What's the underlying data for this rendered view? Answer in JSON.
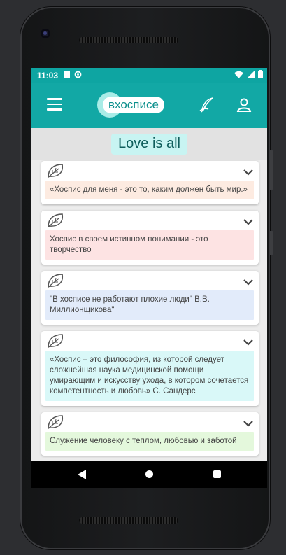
{
  "status_bar": {
    "time": "11:03",
    "icons": [
      "sd-card-icon",
      "sync-icon",
      "wifi-icon",
      "signal-icon",
      "battery-icon"
    ]
  },
  "app_bar": {
    "logo_text": "вхосписе",
    "menu_icon": "hamburger-menu-icon",
    "write_icon": "quill-pen-icon",
    "profile_icon": "person-icon",
    "color": "#12a8a5"
  },
  "section": {
    "title": "Love is all"
  },
  "cards": [
    {
      "text": "«Хоспис для меня - это то, каким должен быть мир.»",
      "bg": "#fdebe1"
    },
    {
      "text": "Хоспис в своем истинном понимании - это творчество",
      "bg": "#fde3e3"
    },
    {
      "text": "\"В хосписе не работают плохие люди\" В.В. Миллионщикова\"",
      "bg": "#e2ebfa"
    },
    {
      "text": "«Хоспис – это философия, из которой следует сложнейшая наука медицинской помощи умирающим и искусству ухода, в котором сочетается компетентность и любовь» С. Сандерс",
      "bg": "#d9f8f8"
    },
    {
      "text": "Служение человеку с теплом, любовью и заботой",
      "bg": "#e4f8dc"
    }
  ],
  "nav_bar": {
    "back_icon": "back-triangle-icon",
    "home_icon": "home-circle-icon",
    "recents_icon": "recents-square-icon"
  }
}
